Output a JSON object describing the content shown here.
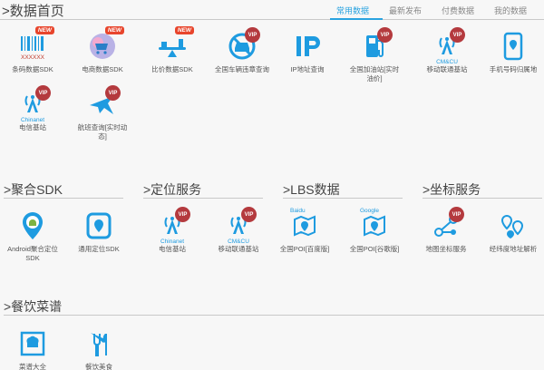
{
  "header": {
    "title": ">数据首页",
    "tabs": [
      "常用数据",
      "最新发布",
      "付费数据",
      "我的数据"
    ]
  },
  "sections": {
    "juhe_sdk": ">聚合SDK",
    "location": ">定位服务",
    "lbs": ">LBS数据",
    "coords": ">坐标服务",
    "food": ">餐饮菜谱"
  },
  "badges": {
    "vip": "VIP",
    "new": "NEW"
  },
  "icon_text": {
    "barcode_sub": "XXXXXX",
    "chinanet": "Chinanet",
    "cmcu": "CM&CU",
    "baidu": "Baidu",
    "google": "Google"
  },
  "items": {
    "barcode": "条码数据SDK",
    "ecommerce": "电商数据SDK",
    "price": "比价数据SDK",
    "violation": "全国车辆违章查询",
    "ip": "IP地址查询",
    "gas": "全国加油站[实时油价]",
    "mobile_base": "移动联通基站",
    "phone_loc": "手机号码归属地",
    "telecom_base": "电信基站",
    "flight": "航班查询[实时动态]",
    "android_sdk": "Android聚合定位SDK",
    "general_sdk": "通用定位SDK",
    "loc_telecom": "电信基站",
    "loc_mobile": "移动联通基站",
    "poi_baidu": "全国POI[百度版]",
    "poi_google": "全国POI[谷歌版]",
    "map_coord": "地图坐标服务",
    "latlng": "经纬度地址解析",
    "recipe": "菜谱大全",
    "catering": "餐饮美食"
  },
  "colors": {
    "accent": "#2aa3e0",
    "vip": "#b43a3e",
    "new": "#e8452c"
  }
}
